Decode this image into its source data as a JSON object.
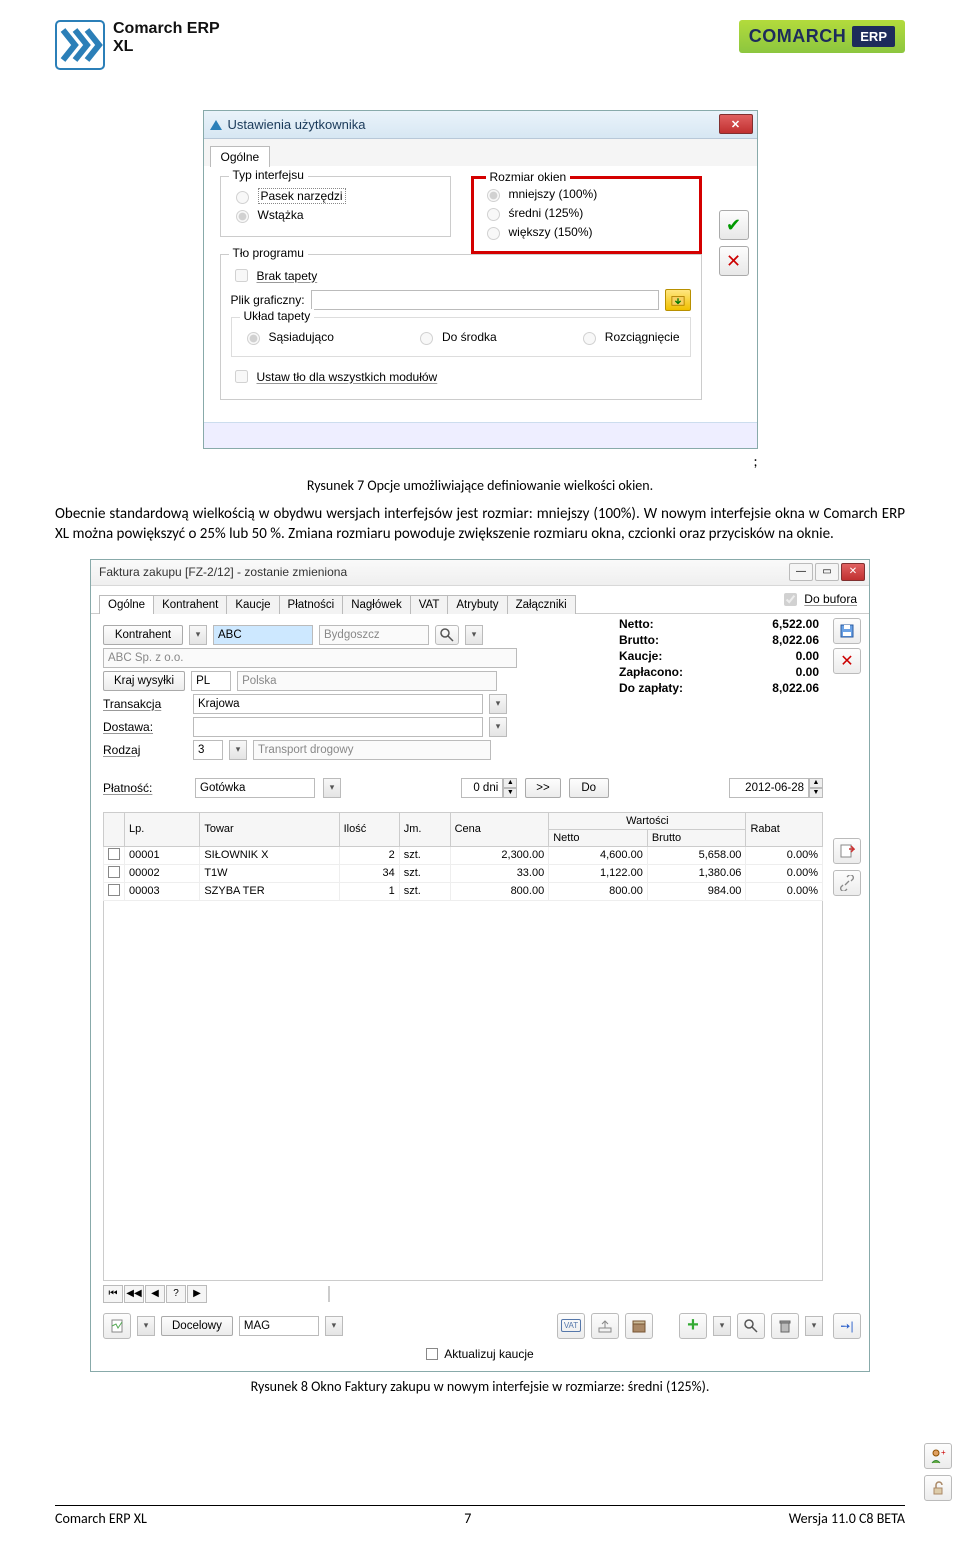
{
  "header": {
    "logo_text_line1": "Comarch ERP",
    "logo_text_line2": "XL",
    "right_brand": "COMARCH",
    "right_badge": "ERP"
  },
  "dialog1": {
    "title": "Ustawienia użytkownika",
    "tab": "Ogólne",
    "fs_typ": "Typ interfejsu",
    "r_pasek": "Pasek narzędzi",
    "r_wstazka": "Wstążka",
    "fs_rozmiar": "Rozmiar okien",
    "r_mniejszy": "mniejszy (100%)",
    "r_sredni": "średni (125%)",
    "r_wiekszy": "większy (150%)",
    "fs_tlo": "Tło programu",
    "c_brak": "Brak tapety",
    "l_plik": "Plik graficzny:",
    "fs_uklad": "Układ tapety",
    "r_sasiad": "Sąsiadująco",
    "r_srodek": "Do środka",
    "r_rozc": "Rozciągnięcie",
    "c_ustaw": "Ustaw tło dla wszystkich modułów"
  },
  "caption1": "Rysunek 7 Opcje umożliwiające definiowanie wielkości okien.",
  "para": "Obecnie standardową wielkością w obydwu wersjach interfejsów jest rozmiar: mniejszy (100%). W nowym interfejsie okna w Comarch ERP XL można powiększyć o 25% lub 50 %. Zmiana rozmiaru powoduje zwiększenie rozmiaru okna, czcionki oraz przycisków na oknie.",
  "dialog2": {
    "title": "Faktura zakupu [FZ-2/12]  - zostanie zmieniona",
    "tabs": [
      "Ogólne",
      "Kontrahent",
      "Kaucje",
      "Płatności",
      "Nagłówek",
      "VAT",
      "Atrybuty",
      "Załączniki"
    ],
    "do_bufora": "Do bufora",
    "btn_kontrahent": "Kontrahent",
    "kontr_code": "ABC",
    "miasto": "Bydgoszcz",
    "kontr_name": "ABC Sp. z o.o.",
    "btn_kraj": "Kraj wysyłki",
    "kraj_code": "PL",
    "kraj_name": "Polska",
    "lbl_trans": "Transakcja",
    "trans_val": "Krajowa",
    "lbl_dostawa": "Dostawa:",
    "lbl_rodzaj": "Rodzaj",
    "rodzaj_val": "3",
    "rodzaj_desc": "Transport drogowy",
    "totals": {
      "Netto:": "6,522.00",
      "Brutto:": "8,022.06",
      "Kaucje:": "0.00",
      "Zapłacono:": "0.00",
      "Do zapłaty:": "8,022.06"
    },
    "lbl_platnosc": "Płatność:",
    "platnosc_val": "Gotówka",
    "dni_val": "0 dni",
    "btn_do": "Do",
    "date_val": "2012-06-28",
    "grid": {
      "h_lp": "Lp.",
      "h_towar": "Towar",
      "h_ilosc": "Ilość",
      "h_jm": "Jm.",
      "h_cena": "Cena",
      "h_wartosci": "Wartości",
      "h_netto": "Netto",
      "h_brutto": "Brutto",
      "h_rabat": "Rabat",
      "rows": [
        {
          "lp": "00001",
          "towar": "SIŁOWNIK X",
          "ilosc": "2",
          "jm": "szt.",
          "cena": "2,300.00",
          "netto": "4,600.00",
          "brutto": "5,658.00",
          "rabat": "0.00%"
        },
        {
          "lp": "00002",
          "towar": "T1W",
          "ilosc": "34",
          "jm": "szt.",
          "cena": "33.00",
          "netto": "1,122.00",
          "brutto": "1,380.06",
          "rabat": "0.00%"
        },
        {
          "lp": "00003",
          "towar": "SZYBA TER",
          "ilosc": "1",
          "jm": "szt.",
          "cena": "800.00",
          "netto": "800.00",
          "brutto": "984.00",
          "rabat": "0.00%"
        }
      ]
    },
    "btn_docelowy": "Docelowy",
    "docelowy_val": "MAG",
    "aktualizuj": "Aktualizuj kaucje"
  },
  "caption2": "Rysunek 8 Okno Faktury zakupu w nowym interfejsie w rozmiarze: średni (125%).",
  "footer": {
    "left": "Comarch ERP XL",
    "center": "7",
    "right": "Wersja 11.0 C8 BETA"
  }
}
